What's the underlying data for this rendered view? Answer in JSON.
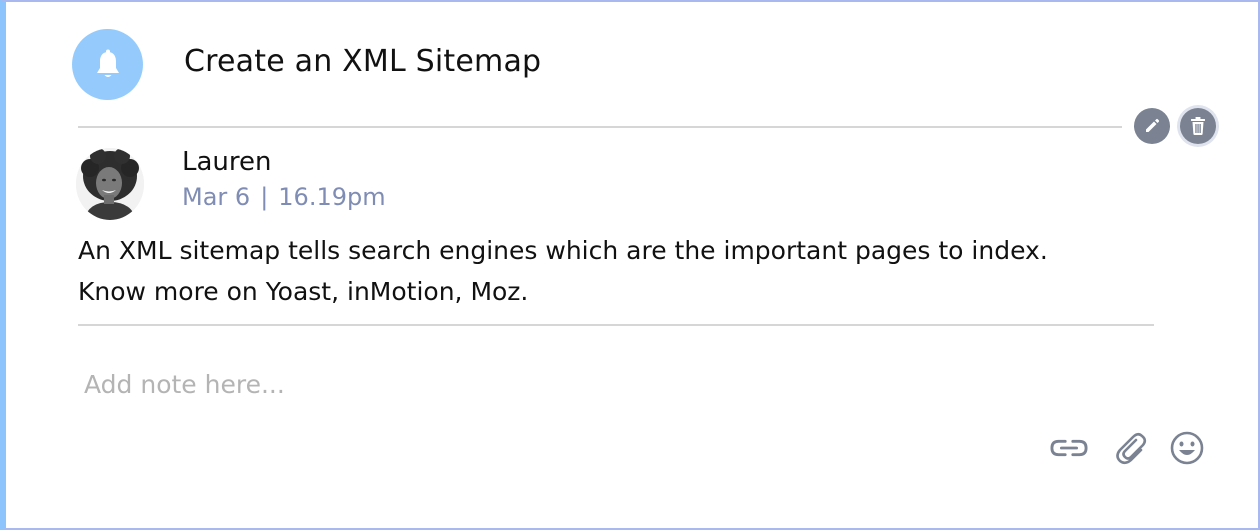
{
  "task": {
    "title": "Create an XML Sitemap",
    "icon": "bell-icon",
    "icon_bg": "#94cbfc"
  },
  "actions": {
    "edit_icon": "pencil-icon",
    "delete_icon": "trash-icon",
    "button_color": "#7b8393"
  },
  "note": {
    "author": "Lauren",
    "date": "Mar 6",
    "separator": "|",
    "time": "16.19pm",
    "body_lines": [
      "An XML sitemap tells search engines which are the important pages to index.",
      "Know more on Yoast, inMotion, Moz."
    ]
  },
  "composer": {
    "placeholder": "Add note here...",
    "tools": [
      "link-icon",
      "paperclip-icon",
      "emoji-icon"
    ]
  },
  "colors": {
    "accent_border": "#8cc4fb",
    "timestamp": "#7f8db4"
  }
}
